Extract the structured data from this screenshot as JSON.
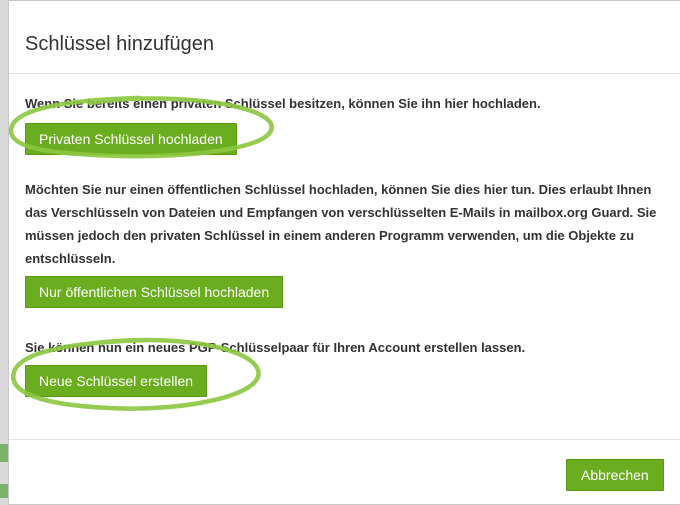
{
  "dialog": {
    "title": "Schlüssel hinzufügen",
    "sections": [
      {
        "text": "Wenn Sie bereits einen privaten Schlüssel besitzen, können Sie ihn hier hochladen.",
        "button": "Privaten Schlüssel hochladen"
      },
      {
        "text": "Möchten Sie nur einen öffentlichen Schlüssel hochladen, können Sie dies hier tun. Dies erlaubt Ihnen das Verschlüsseln von Dateien und Empfangen von verschlüsselten E-Mails in mailbox.org Guard. Sie müssen jedoch den privaten Schlüssel in einem anderen Programm verwenden, um die Objekte zu entschlüsseln.",
        "button": "Nur öffentlichen Schlüssel hochladen"
      },
      {
        "text": "Sie können nun ein neues PGP-Schlüsselpaar für Ihren Account erstellen lassen.",
        "button": "Neue Schlüssel erstellen"
      }
    ],
    "cancel_label": "Abbrechen"
  },
  "colors": {
    "button_green": "#6aad1e",
    "annotation_green": "#8cc63f"
  }
}
